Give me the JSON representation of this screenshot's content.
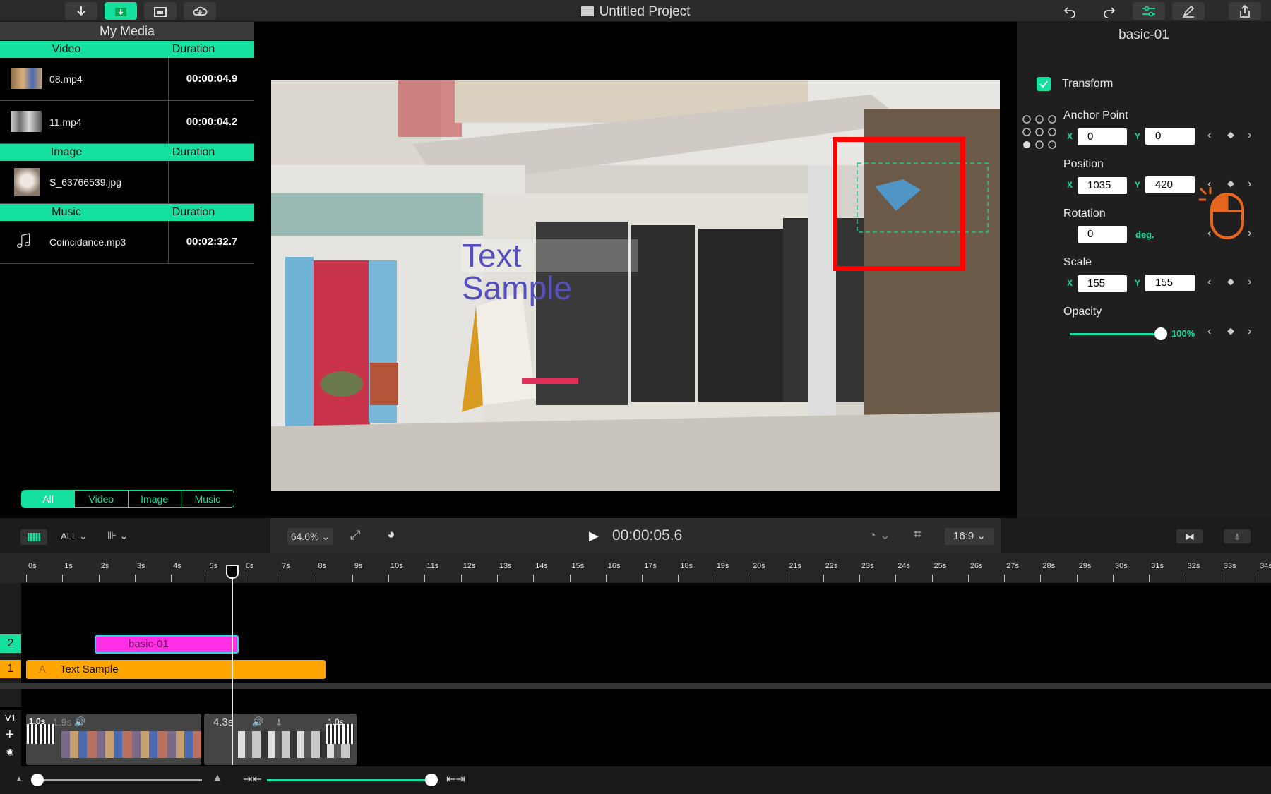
{
  "window": {
    "title": "Untitled Project"
  },
  "toolbar": {
    "left_icons": [
      "download-icon",
      "import-media-icon",
      "folder-icon",
      "cloud-icon"
    ],
    "right_icons": [
      "undo-icon",
      "redo-icon",
      "sliders-icon",
      "pen-icon",
      "share-icon"
    ]
  },
  "media": {
    "title": "My Media",
    "sections": [
      {
        "header": "Video",
        "dur_header": "Duration",
        "items": [
          {
            "name": "08.mp4",
            "duration": "00:00:04.9"
          },
          {
            "name": "11.mp4",
            "duration": "00:00:04.2"
          }
        ]
      },
      {
        "header": "Image",
        "dur_header": "Duration",
        "items": [
          {
            "name": "S_63766539.jpg",
            "duration": ""
          }
        ]
      },
      {
        "header": "Music",
        "dur_header": "Duration",
        "items": [
          {
            "name": "Coincidance.mp3",
            "duration": "00:02:32.7"
          }
        ]
      }
    ],
    "filters": [
      "All",
      "Video",
      "Image",
      "Music"
    ],
    "selected_filter": "All"
  },
  "preview": {
    "overlay_text": "Text Sample"
  },
  "props": {
    "clip_name": "basic-01",
    "transform_label": "Transform",
    "anchor": {
      "label": "Anchor Point",
      "x": "0",
      "y": "0"
    },
    "position": {
      "label": "Position",
      "x": "1035",
      "y": "420"
    },
    "rotation": {
      "label": "Rotation",
      "value": "0",
      "unit": "deg."
    },
    "scale": {
      "label": "Scale",
      "x": "155",
      "y": "155"
    },
    "opacity": {
      "label": "Opacity",
      "value": "100%",
      "level": 1.0
    },
    "x_label": "X",
    "y_label": "Y"
  },
  "controls": {
    "track_filter": "ALL",
    "zoom": "64.6%",
    "timecode": "00:00:05.6",
    "aspect": "16:9"
  },
  "timeline": {
    "ticks": [
      "0s",
      "1s",
      "2s",
      "3s",
      "4s",
      "5s",
      "6s",
      "7s",
      "8s",
      "9s",
      "10s",
      "11s",
      "12s",
      "13s",
      "14s",
      "15s",
      "16s",
      "17s",
      "18s",
      "19s",
      "20s",
      "21s",
      "22s",
      "23s",
      "24s",
      "25s",
      "26s",
      "27s",
      "28s",
      "29s",
      "30s",
      "31s",
      "32s",
      "33s",
      "34s"
    ],
    "track2": {
      "num": "2",
      "clip": "basic-01"
    },
    "track1": {
      "num": "1",
      "clip": "Text Sample"
    },
    "video_track": {
      "label": "V1",
      "transition1": "1.0s",
      "clip_dur_hidden": "1.9s",
      "clip2_dur": "4.3s",
      "transition2": "1.0s"
    }
  },
  "colors": {
    "accent": "#14e0a0",
    "clip_magenta": "#ff2fe6",
    "clip_orange": "#ffa500",
    "highlight": "#ff0000"
  }
}
